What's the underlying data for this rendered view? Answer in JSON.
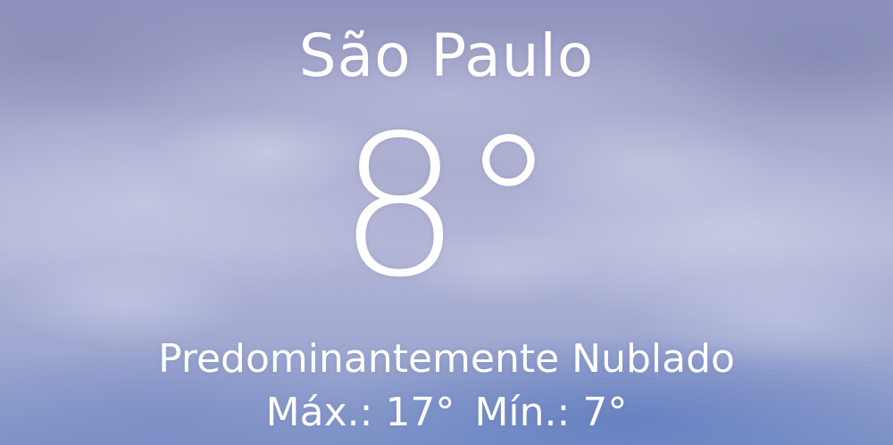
{
  "weather": {
    "city": "São Paulo",
    "temperature": "8°",
    "condition": "Predominantemente Nublado",
    "high_label": "Máx.:",
    "high_value": "17°",
    "low_label": "Mín.:",
    "low_value": "7°"
  },
  "colors": {
    "text": "#ffffff",
    "sky_top": "#8f93bd",
    "sky_bottom": "#7f95c8"
  }
}
